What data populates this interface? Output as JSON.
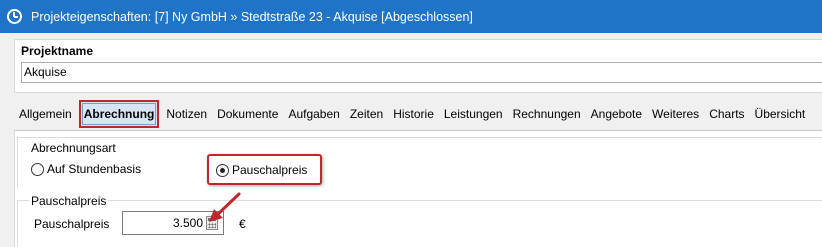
{
  "window": {
    "title": "Projekteigenschaften: [7] Ny GmbH » Stedtstraße 23 - Akquise [Abgeschlossen]",
    "title_bar_color": "#1f74c8"
  },
  "project": {
    "name_label": "Projektname",
    "name_value": "Akquise"
  },
  "tabs": [
    {
      "label": "Allgemein"
    },
    {
      "label": "Abrechnung",
      "active": true
    },
    {
      "label": "Notizen"
    },
    {
      "label": "Dokumente"
    },
    {
      "label": "Aufgaben"
    },
    {
      "label": "Zeiten"
    },
    {
      "label": "Historie"
    },
    {
      "label": "Leistungen"
    },
    {
      "label": "Rechnungen"
    },
    {
      "label": "Angebote"
    },
    {
      "label": "Weiteres"
    },
    {
      "label": "Charts"
    },
    {
      "label": "Übersicht"
    }
  ],
  "billing": {
    "group_label": "Abrechnungsart",
    "option_hourly": "Auf Stundenbasis",
    "option_flat": "Pauschalpreis",
    "selected": "Pauschalpreis"
  },
  "flat_price": {
    "group_label": "Pauschalpreis",
    "field_label": "Pauschalpreis",
    "value": "3.500",
    "currency": "€"
  },
  "annotation_color": "#c0272d"
}
